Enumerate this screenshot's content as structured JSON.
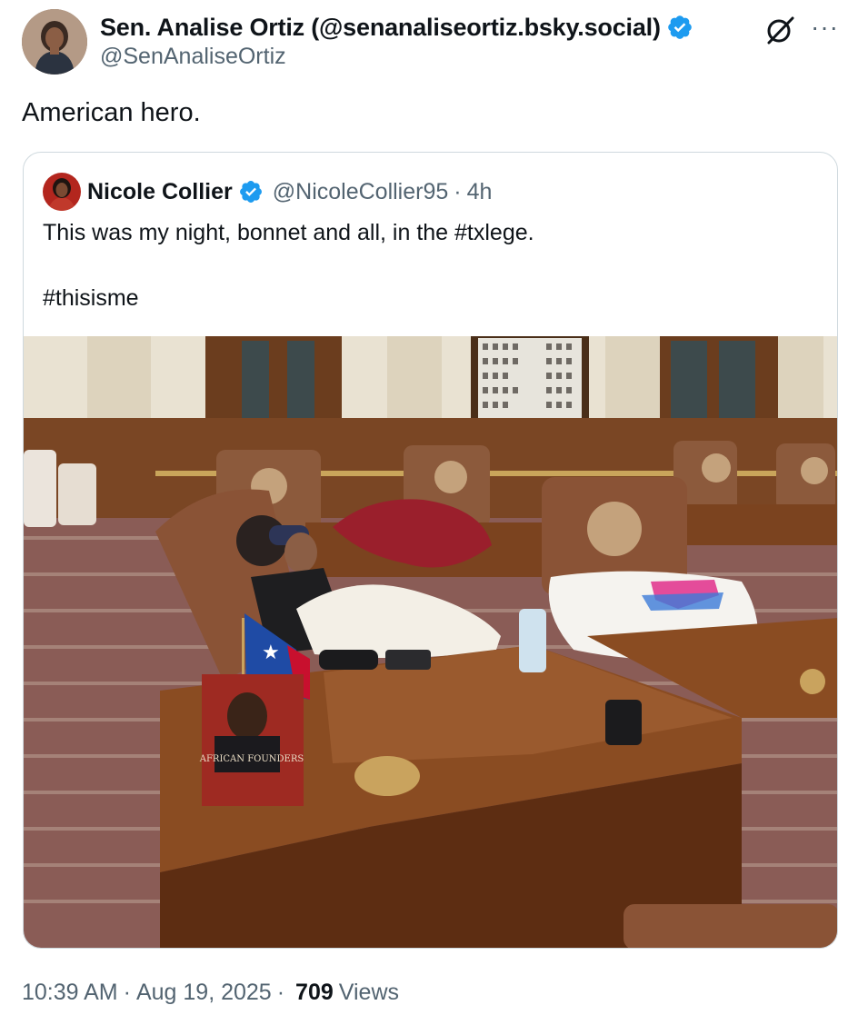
{
  "author": {
    "display_name": "Sen. Analise Ortiz (@senanaliseortiz.bsky.social)",
    "handle": "@SenAnaliseOrtiz",
    "verified_icon": "verified-badge-icon",
    "avatar": "avatar-photo"
  },
  "header_actions": {
    "grok_icon": "grok-icon",
    "more_label": "···"
  },
  "tweet": {
    "text": "American hero."
  },
  "quoted_tweet": {
    "display_name": "Nicole Collier",
    "handle": "@NicoleCollier95",
    "separator": "·",
    "time": "4h",
    "text": "This was my night, bonnet and all, in the #txlege.\n\n#thisisme",
    "photo": "photo: woman asleep in chair at Texas House desk, Texas flag, book, pillow",
    "book_title": "AFRICAN FOUNDERS"
  },
  "footer": {
    "time": "10:39 AM",
    "sep1": "·",
    "date": "Aug 19, 2025",
    "sep2": "·",
    "views_count": "709",
    "views_label": "Views"
  },
  "colors": {
    "verified": "#1d9bf0",
    "secondary_text": "#536471",
    "border": "#cfd9de"
  }
}
